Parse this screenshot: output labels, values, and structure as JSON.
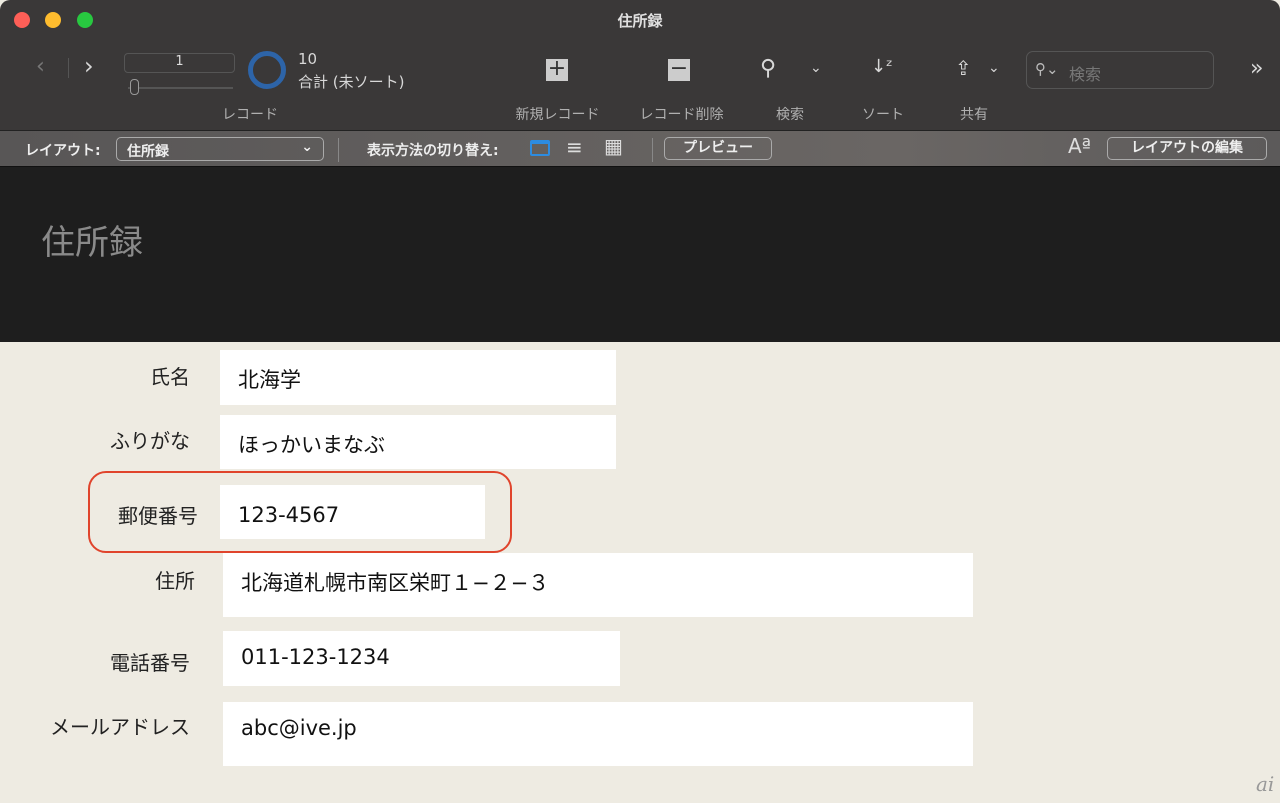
{
  "window": {
    "title": "住所録"
  },
  "toolbar": {
    "record_number": "1",
    "record_count": "10",
    "record_status": "合計 (未ソート)",
    "records_label": "レコード",
    "new_record_label": "新規レコード",
    "delete_record_label": "レコード削除",
    "find_label": "検索",
    "sort_label": "ソート",
    "share_label": "共有",
    "search_placeholder": "検索",
    "accent_color": "#2d64a8"
  },
  "layout_bar": {
    "layout_label": "レイアウト:",
    "layout_value": "住所録",
    "view_as_label": "表示方法の切り替え:",
    "preview_label": "プレビュー",
    "edit_layout_label": "レイアウトの編集"
  },
  "header": {
    "title": "住所録"
  },
  "fields": [
    {
      "label": "氏名",
      "value": "北海学"
    },
    {
      "label": "ふりがな",
      "value": "ほっかいまなぶ"
    },
    {
      "label": "郵便番号",
      "value": "123-4567"
    },
    {
      "label": "住所",
      "value": "北海道札幌市南区栄町１−２−３"
    },
    {
      "label": "電話番号",
      "value": "011-123-1234"
    },
    {
      "label": "メールアドレス",
      "value": "abc@ive.jp"
    }
  ],
  "highlight_color": "#e0442c",
  "watermark": "ai"
}
